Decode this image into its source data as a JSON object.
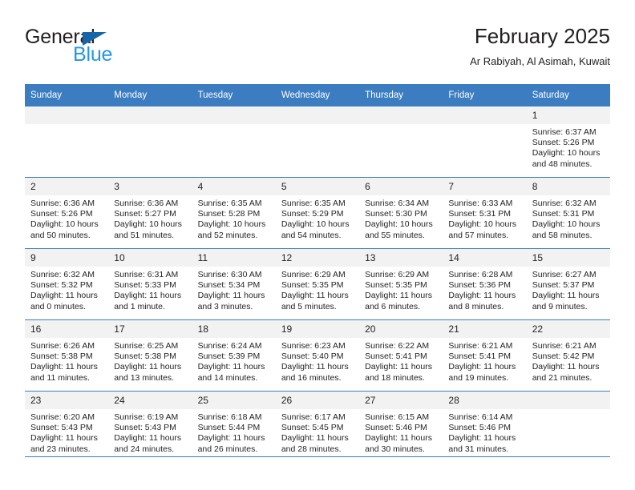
{
  "brand": {
    "name_part1": "General",
    "name_part2": "Blue",
    "accent_color": "#2196e8",
    "triangle_color": "#1565a8"
  },
  "header": {
    "title": "February 2025",
    "subtitle": "Ar Rabiyah, Al Asimah, Kuwait"
  },
  "theme": {
    "header_row_bg": "#3b7dc0",
    "daynum_bg": "#f2f2f2",
    "text_color": "#231f20"
  },
  "calendar": {
    "weekdays": [
      "Sunday",
      "Monday",
      "Tuesday",
      "Wednesday",
      "Thursday",
      "Friday",
      "Saturday"
    ],
    "weeks": [
      [
        {
          "day": "",
          "sunrise": "",
          "sunset": "",
          "daylight": "",
          "empty": true
        },
        {
          "day": "",
          "sunrise": "",
          "sunset": "",
          "daylight": "",
          "empty": true
        },
        {
          "day": "",
          "sunrise": "",
          "sunset": "",
          "daylight": "",
          "empty": true
        },
        {
          "day": "",
          "sunrise": "",
          "sunset": "",
          "daylight": "",
          "empty": true
        },
        {
          "day": "",
          "sunrise": "",
          "sunset": "",
          "daylight": "",
          "empty": true
        },
        {
          "day": "",
          "sunrise": "",
          "sunset": "",
          "daylight": "",
          "empty": true
        },
        {
          "day": "1",
          "sunrise": "Sunrise: 6:37 AM",
          "sunset": "Sunset: 5:26 PM",
          "daylight": "Daylight: 10 hours and 48 minutes.",
          "empty": false
        }
      ],
      [
        {
          "day": "2",
          "sunrise": "Sunrise: 6:36 AM",
          "sunset": "Sunset: 5:26 PM",
          "daylight": "Daylight: 10 hours and 50 minutes.",
          "empty": false
        },
        {
          "day": "3",
          "sunrise": "Sunrise: 6:36 AM",
          "sunset": "Sunset: 5:27 PM",
          "daylight": "Daylight: 10 hours and 51 minutes.",
          "empty": false
        },
        {
          "day": "4",
          "sunrise": "Sunrise: 6:35 AM",
          "sunset": "Sunset: 5:28 PM",
          "daylight": "Daylight: 10 hours and 52 minutes.",
          "empty": false
        },
        {
          "day": "5",
          "sunrise": "Sunrise: 6:35 AM",
          "sunset": "Sunset: 5:29 PM",
          "daylight": "Daylight: 10 hours and 54 minutes.",
          "empty": false
        },
        {
          "day": "6",
          "sunrise": "Sunrise: 6:34 AM",
          "sunset": "Sunset: 5:30 PM",
          "daylight": "Daylight: 10 hours and 55 minutes.",
          "empty": false
        },
        {
          "day": "7",
          "sunrise": "Sunrise: 6:33 AM",
          "sunset": "Sunset: 5:31 PM",
          "daylight": "Daylight: 10 hours and 57 minutes.",
          "empty": false
        },
        {
          "day": "8",
          "sunrise": "Sunrise: 6:32 AM",
          "sunset": "Sunset: 5:31 PM",
          "daylight": "Daylight: 10 hours and 58 minutes.",
          "empty": false
        }
      ],
      [
        {
          "day": "9",
          "sunrise": "Sunrise: 6:32 AM",
          "sunset": "Sunset: 5:32 PM",
          "daylight": "Daylight: 11 hours and 0 minutes.",
          "empty": false
        },
        {
          "day": "10",
          "sunrise": "Sunrise: 6:31 AM",
          "sunset": "Sunset: 5:33 PM",
          "daylight": "Daylight: 11 hours and 1 minute.",
          "empty": false
        },
        {
          "day": "11",
          "sunrise": "Sunrise: 6:30 AM",
          "sunset": "Sunset: 5:34 PM",
          "daylight": "Daylight: 11 hours and 3 minutes.",
          "empty": false
        },
        {
          "day": "12",
          "sunrise": "Sunrise: 6:29 AM",
          "sunset": "Sunset: 5:35 PM",
          "daylight": "Daylight: 11 hours and 5 minutes.",
          "empty": false
        },
        {
          "day": "13",
          "sunrise": "Sunrise: 6:29 AM",
          "sunset": "Sunset: 5:35 PM",
          "daylight": "Daylight: 11 hours and 6 minutes.",
          "empty": false
        },
        {
          "day": "14",
          "sunrise": "Sunrise: 6:28 AM",
          "sunset": "Sunset: 5:36 PM",
          "daylight": "Daylight: 11 hours and 8 minutes.",
          "empty": false
        },
        {
          "day": "15",
          "sunrise": "Sunrise: 6:27 AM",
          "sunset": "Sunset: 5:37 PM",
          "daylight": "Daylight: 11 hours and 9 minutes.",
          "empty": false
        }
      ],
      [
        {
          "day": "16",
          "sunrise": "Sunrise: 6:26 AM",
          "sunset": "Sunset: 5:38 PM",
          "daylight": "Daylight: 11 hours and 11 minutes.",
          "empty": false
        },
        {
          "day": "17",
          "sunrise": "Sunrise: 6:25 AM",
          "sunset": "Sunset: 5:38 PM",
          "daylight": "Daylight: 11 hours and 13 minutes.",
          "empty": false
        },
        {
          "day": "18",
          "sunrise": "Sunrise: 6:24 AM",
          "sunset": "Sunset: 5:39 PM",
          "daylight": "Daylight: 11 hours and 14 minutes.",
          "empty": false
        },
        {
          "day": "19",
          "sunrise": "Sunrise: 6:23 AM",
          "sunset": "Sunset: 5:40 PM",
          "daylight": "Daylight: 11 hours and 16 minutes.",
          "empty": false
        },
        {
          "day": "20",
          "sunrise": "Sunrise: 6:22 AM",
          "sunset": "Sunset: 5:41 PM",
          "daylight": "Daylight: 11 hours and 18 minutes.",
          "empty": false
        },
        {
          "day": "21",
          "sunrise": "Sunrise: 6:21 AM",
          "sunset": "Sunset: 5:41 PM",
          "daylight": "Daylight: 11 hours and 19 minutes.",
          "empty": false
        },
        {
          "day": "22",
          "sunrise": "Sunrise: 6:21 AM",
          "sunset": "Sunset: 5:42 PM",
          "daylight": "Daylight: 11 hours and 21 minutes.",
          "empty": false
        }
      ],
      [
        {
          "day": "23",
          "sunrise": "Sunrise: 6:20 AM",
          "sunset": "Sunset: 5:43 PM",
          "daylight": "Daylight: 11 hours and 23 minutes.",
          "empty": false
        },
        {
          "day": "24",
          "sunrise": "Sunrise: 6:19 AM",
          "sunset": "Sunset: 5:43 PM",
          "daylight": "Daylight: 11 hours and 24 minutes.",
          "empty": false
        },
        {
          "day": "25",
          "sunrise": "Sunrise: 6:18 AM",
          "sunset": "Sunset: 5:44 PM",
          "daylight": "Daylight: 11 hours and 26 minutes.",
          "empty": false
        },
        {
          "day": "26",
          "sunrise": "Sunrise: 6:17 AM",
          "sunset": "Sunset: 5:45 PM",
          "daylight": "Daylight: 11 hours and 28 minutes.",
          "empty": false
        },
        {
          "day": "27",
          "sunrise": "Sunrise: 6:15 AM",
          "sunset": "Sunset: 5:46 PM",
          "daylight": "Daylight: 11 hours and 30 minutes.",
          "empty": false
        },
        {
          "day": "28",
          "sunrise": "Sunrise: 6:14 AM",
          "sunset": "Sunset: 5:46 PM",
          "daylight": "Daylight: 11 hours and 31 minutes.",
          "empty": false
        },
        {
          "day": "",
          "sunrise": "",
          "sunset": "",
          "daylight": "",
          "empty": true
        }
      ]
    ]
  }
}
